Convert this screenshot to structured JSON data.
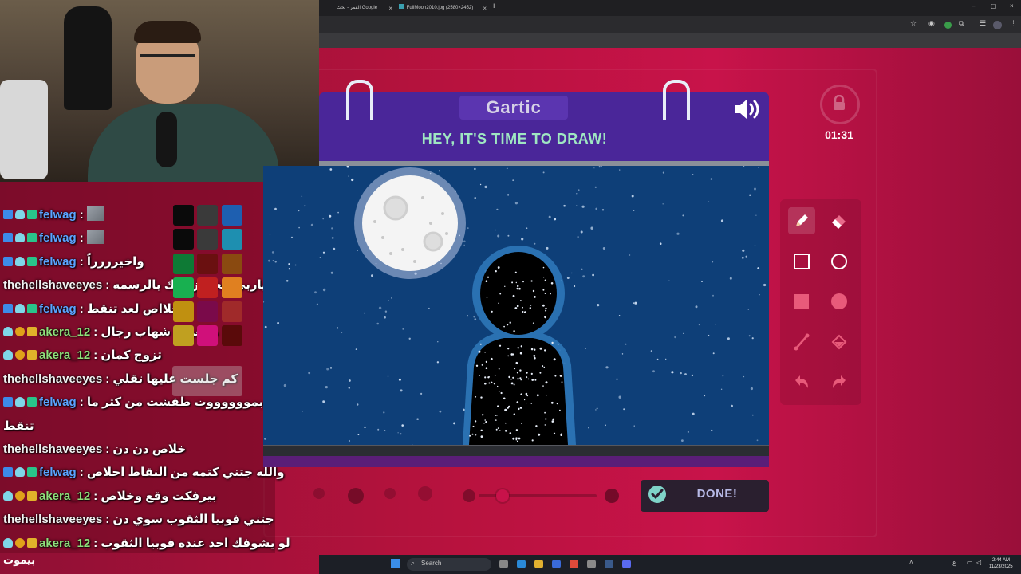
{
  "browser": {
    "tabs": [
      {
        "label": "القمر - بحث Google",
        "close": "×"
      },
      {
        "label": "FullMoon2010.jpg (2580×2452)",
        "close": "×"
      }
    ],
    "new_tab": "+",
    "window_controls": [
      "–",
      "▢",
      "×"
    ]
  },
  "game": {
    "logo": "Gartic",
    "title": "HEY, IT'S TIME TO DRAW!",
    "timer": "01:31",
    "done_label": "DONE!",
    "tools": [
      "pencil-icon",
      "eraser-icon",
      "square-outline-icon",
      "circle-outline-icon",
      "square-filled-icon",
      "circle-filled-icon",
      "line-icon",
      "fill-bucket-icon",
      "undo-icon",
      "redo-icon"
    ],
    "colors": {
      "header": "#4a2699",
      "canvas": "#0e3f78",
      "title": "#9fe6c2",
      "accent": "#c8124a"
    }
  },
  "palette": {
    "colors": [
      "#0a0a0a",
      "#3a3a3a",
      "#1e5fb0",
      "#0a0a0a",
      "#3a3a3a",
      "#1e8fb0",
      "#0e7a35",
      "#6a1010",
      "#8a4a10",
      "#18b050",
      "#c02020",
      "#e08020",
      "#c09010",
      "#7a0a4a",
      "#a02a2a",
      "#c0a020",
      "#d0107a",
      "#5a0a0a"
    ]
  },
  "chat": {
    "messages": [
      {
        "user": "felwag",
        "color": "blue",
        "badges": [
          "blue",
          "ice",
          "green"
        ],
        "text": ":",
        "emote": true
      },
      {
        "user": "felwag",
        "color": "blue",
        "badges": [
          "blue",
          "ice",
          "green"
        ],
        "text": ":",
        "emote": true
      },
      {
        "user": "felwag",
        "color": "blue",
        "badges": [
          "blue",
          "ice",
          "green"
        ],
        "text": ": واخيرررراً"
      },
      {
        "user": "thehellshaveeyes",
        "color": "white",
        "badges": [],
        "text": ": ياربي العجوز خلك بالرسمه"
      },
      {
        "user": "felwag",
        "color": "blue",
        "badges": [
          "blue",
          "ice",
          "green"
        ],
        "text": ": خلااص لعد تنقط"
      },
      {
        "user": "akera_12",
        "color": "green",
        "badges": [
          "ice",
          "gold",
          "crown"
        ],
        "text": ": ماتعرف شهاب رجال"
      },
      {
        "user": "akera_12",
        "color": "green",
        "badges": [
          "ice",
          "gold",
          "crown"
        ],
        "text": ": تزوج كمان"
      },
      {
        "user": "thehellshaveeyes",
        "color": "white",
        "badges": [],
        "text": ": كم جلست عليها تقلي"
      },
      {
        "user": "felwag",
        "color": "blue",
        "badges": [
          "blue",
          "ice",
          "green"
        ],
        "text": ": والله بمووووووت طفشت من كثر ما"
      },
      {
        "user": "",
        "color": "white",
        "badges": [],
        "text": "تنقط"
      },
      {
        "user": "thehellshaveeyes",
        "color": "white",
        "badges": [],
        "text": ": خلاص دن دن"
      },
      {
        "user": "felwag",
        "color": "blue",
        "badges": [
          "blue",
          "ice",
          "green"
        ],
        "text": ": والله جتني كتمه من النقاط اخلاص"
      },
      {
        "user": "akera_12",
        "color": "green",
        "badges": [
          "ice",
          "gold",
          "crown"
        ],
        "text": ": بيرفكت وقع وخلاص"
      },
      {
        "user": "thehellshaveeyes",
        "color": "white",
        "badges": [],
        "text": ": جتني فوبيا الثقوب سوي دن"
      },
      {
        "user": "akera_12",
        "color": "green",
        "badges": [
          "ice",
          "gold",
          "crown"
        ],
        "text": ": لو يشوفك احد عنده فوبيا الثقوب"
      }
    ],
    "streamer_label": "بيموت"
  },
  "taskbar": {
    "search_label": "Search",
    "clock_time": "2:44 AM",
    "clock_date": "11/23/2025",
    "lang": "ع"
  }
}
